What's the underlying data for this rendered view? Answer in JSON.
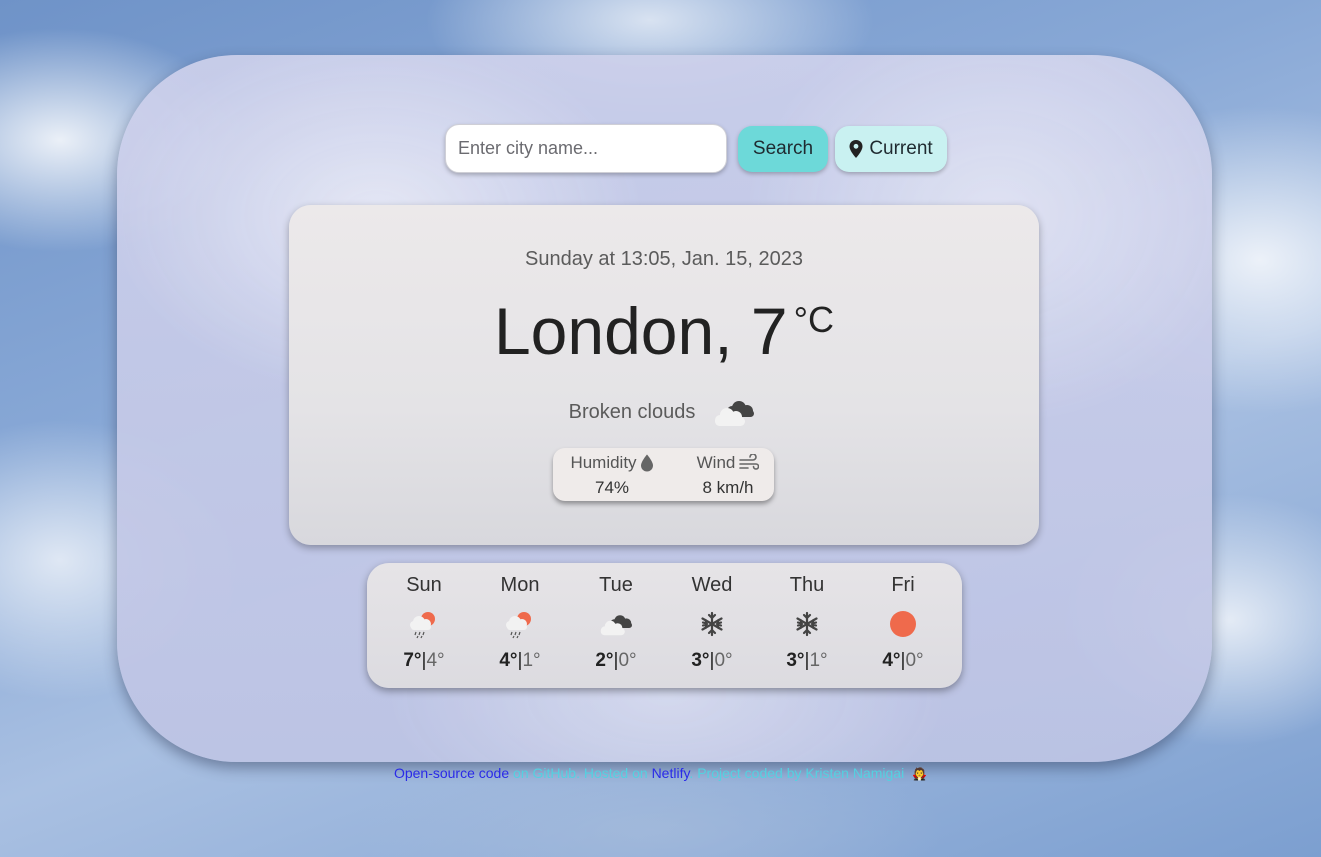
{
  "search": {
    "placeholder": "Enter city name...",
    "value": ""
  },
  "buttons": {
    "search_label": "Search",
    "current_label": "Current"
  },
  "weather": {
    "date": "Sunday at 13:05, Jan. 15, 2023",
    "city": "London,",
    "temperature": "7",
    "unit": "°C",
    "description": "Broken clouds",
    "humidity_label": "Humidity",
    "humidity_value": "74%",
    "wind_label": "Wind",
    "wind_value": "8 km/h"
  },
  "forecast": [
    {
      "day": "Sun",
      "icon": "rain-sun-icon",
      "high": "7°",
      "low": "4°"
    },
    {
      "day": "Mon",
      "icon": "rain-sun-icon",
      "high": "4°",
      "low": "1°"
    },
    {
      "day": "Tue",
      "icon": "broken-clouds-icon",
      "high": "2°",
      "low": "0°"
    },
    {
      "day": "Wed",
      "icon": "snowflake-icon",
      "high": "3°",
      "low": "0°"
    },
    {
      "day": "Thu",
      "icon": "snowflake-icon",
      "high": "3°",
      "low": "1°"
    },
    {
      "day": "Fri",
      "icon": "sun-icon",
      "high": "4°",
      "low": "0°"
    }
  ],
  "footer": {
    "link1": "Open-source code",
    "text1": " on GitHub. Hosted on ",
    "link2": "Netlify",
    "text2": ". Project coded by Kristen Namigai",
    "emoji": "🧛"
  },
  "colors": {
    "accent": "#6dd9d9",
    "accent_light": "#c9f1f1",
    "sun": "#ef6a4c",
    "link": "#2a2ae8",
    "footer_text": "#54d1e0"
  }
}
